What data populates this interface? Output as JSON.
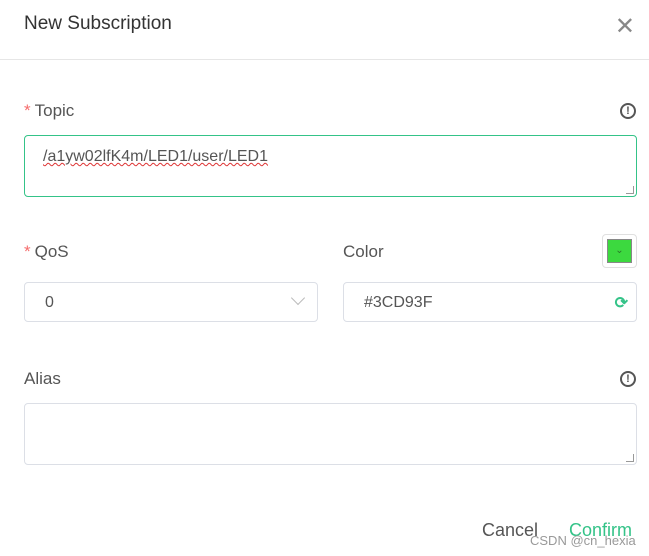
{
  "dialog": {
    "title": "New Subscription"
  },
  "topic": {
    "label": "Topic",
    "value": "/a1yw02lfK4m/LED1/user/LED1"
  },
  "qos": {
    "label": "QoS",
    "value": "0"
  },
  "color": {
    "label": "Color",
    "value": "#3CD93F"
  },
  "alias": {
    "label": "Alias",
    "value": ""
  },
  "actions": {
    "cancel": "Cancel",
    "confirm": "Confirm"
  },
  "watermark": "CSDN @cn_hexia",
  "colors": {
    "accent": "#34C388",
    "swatch": "#3CD93F",
    "required": "#F56C6C"
  }
}
